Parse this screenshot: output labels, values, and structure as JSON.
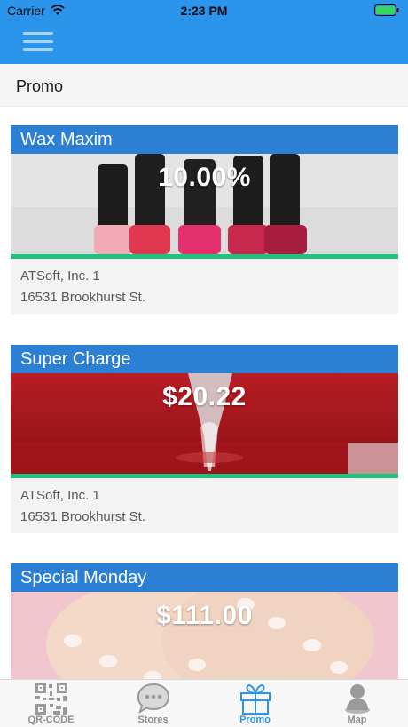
{
  "status_bar": {
    "carrier": "Carrier",
    "time": "2:23 PM"
  },
  "header": {
    "menu_icon": "hamburger-icon"
  },
  "page": {
    "title": "Promo"
  },
  "promos": [
    {
      "title": "Wax Maxim",
      "value": "10.00%",
      "store": "ATSoft, Inc. 1",
      "address": "16531 Brookhurst St.",
      "image": "nail-polish-bottles"
    },
    {
      "title": "Super Charge",
      "value": "$20.22",
      "store": "ATSoft, Inc. 1",
      "address": "16531 Brookhurst St.",
      "image": "red-background-faucet"
    },
    {
      "title": "Special Monday",
      "value": "$111.00",
      "store": "",
      "address": "",
      "image": "manicured-hands"
    }
  ],
  "tabs": [
    {
      "label": "QR-CODE",
      "icon": "qr-code-icon",
      "active": false
    },
    {
      "label": "Stores",
      "icon": "speech-bubble-icon",
      "active": false
    },
    {
      "label": "Promo",
      "icon": "gift-icon",
      "active": true
    },
    {
      "label": "Map",
      "icon": "person-pin-icon",
      "active": false
    }
  ],
  "colors": {
    "header": "#2b94eb",
    "card_title": "#2b7fd4",
    "accent": "#20c07d",
    "active_tab": "#2b94eb"
  }
}
